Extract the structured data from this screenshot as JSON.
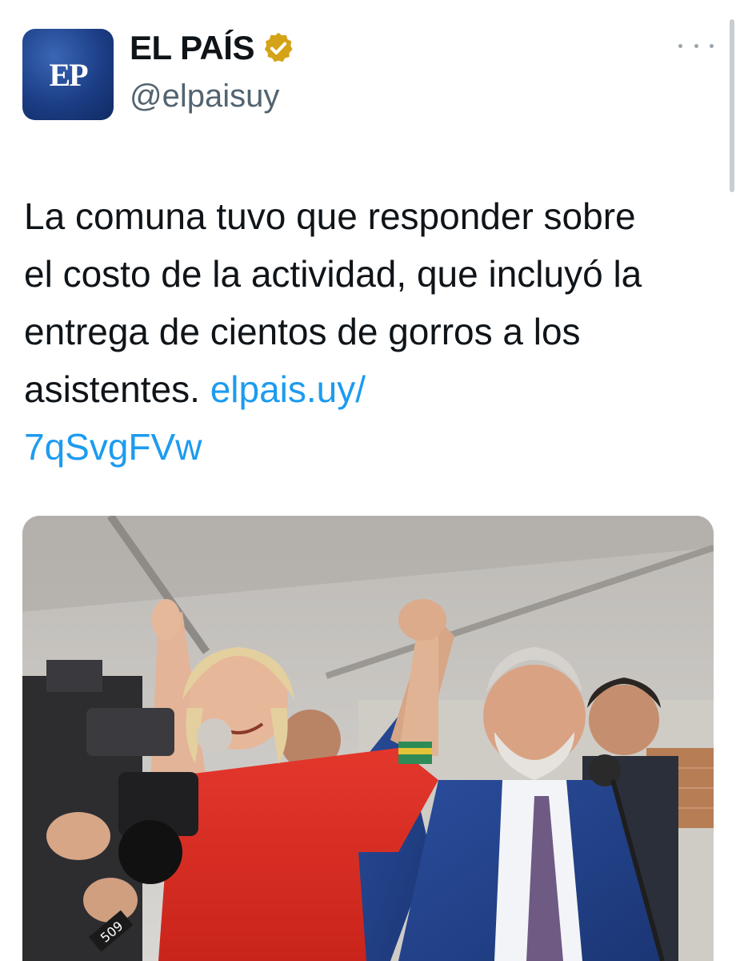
{
  "account": {
    "avatar_text": "EP",
    "display_name": "EL PAÍS",
    "handle": "@elpaisuy",
    "verified_badge_color": "#d4a318"
  },
  "menu": {
    "more_icon": "ellipsis-icon"
  },
  "tweet": {
    "text": "La comuna tuvo que responder sobre el costo de la actividad, que incluyó la entrega de cientos de gorros a los asistentes.",
    "link_text": "elpais.uy/\n7qSvgFVw",
    "link_color": "#1d9bf0"
  },
  "media": {
    "camera_label": "509"
  }
}
